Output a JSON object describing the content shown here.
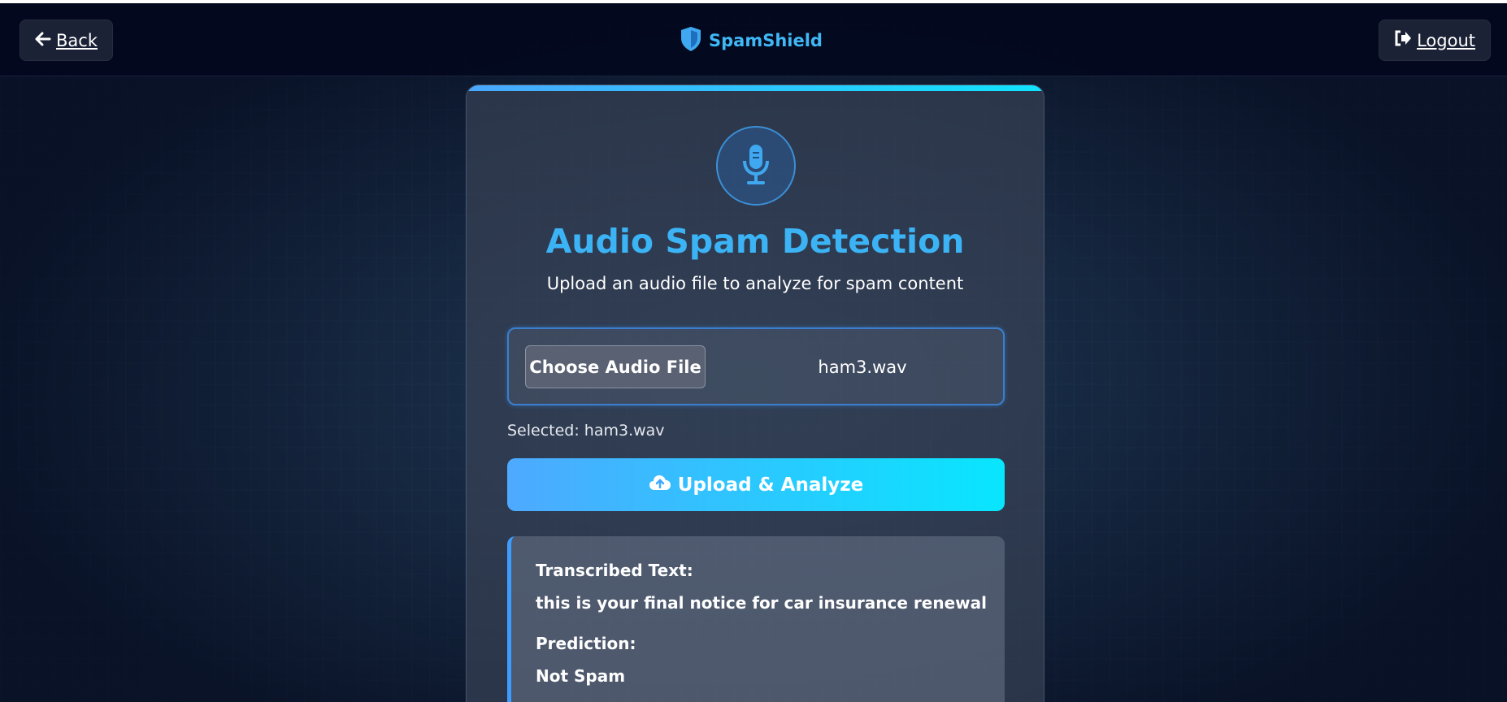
{
  "header": {
    "back_label": "Back",
    "brand_name": "SpamShield",
    "logout_label": "Logout"
  },
  "card": {
    "title": "Audio Spam Detection",
    "subtitle": "Upload an audio file to analyze for spam content",
    "choose_label": "Choose Audio File",
    "file_name": "ham3.wav",
    "selected_text": "Selected: ham3.wav",
    "upload_label": "Upload & Analyze"
  },
  "result": {
    "transcribed_label": "Transcribed Text:",
    "transcribed_text": "this is your final notice for car insurance renewal",
    "prediction_label": "Prediction:",
    "prediction_value": "Not Spam"
  },
  "colors": {
    "accent": "#3bb3f4",
    "button_gradient_start": "#4ea9ff",
    "button_gradient_end": "#08e6ff",
    "header_bg": "#03081e"
  },
  "icons": [
    "arrow-left-icon",
    "shield-icon",
    "logout-icon",
    "microphone-icon",
    "cloud-upload-icon"
  ]
}
